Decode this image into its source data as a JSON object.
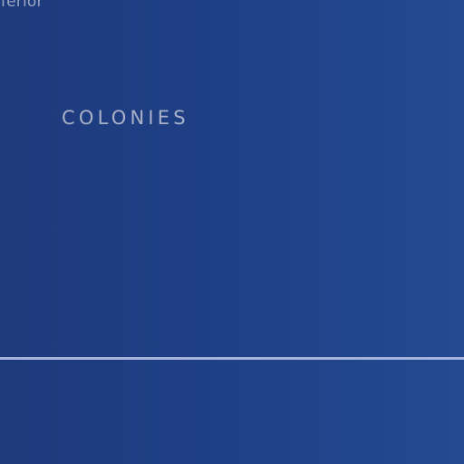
{
  "header": {
    "clipped_text": "iferior"
  },
  "section": {
    "title": "COLONIES"
  },
  "colors": {
    "background_left": "#1d3a7c",
    "background_right": "#234a93",
    "divider": "#a6b3dc",
    "text": "#a8b1c7"
  }
}
